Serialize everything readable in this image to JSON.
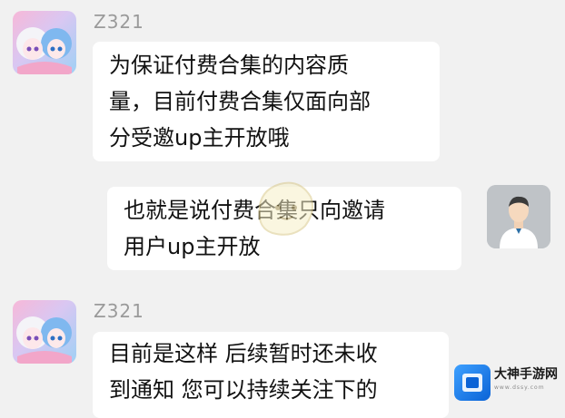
{
  "messages": [
    {
      "sender": "Z321",
      "lines": [
        "为保证付费合集的内容质",
        "量，目前付费合集仅面向部",
        "分受邀up主开放哦"
      ]
    },
    {
      "lines": [
        "也就是说付费合集只向邀请",
        "用户up主开放"
      ]
    },
    {
      "sender": "Z321",
      "lines": [
        "目前是这样 后续暂时还未收",
        "到通知 您可以持续关注下的"
      ]
    }
  ],
  "watermark": {
    "name": "大神手游网",
    "url": "www.dssy.com",
    "color": "#0b63d6"
  }
}
